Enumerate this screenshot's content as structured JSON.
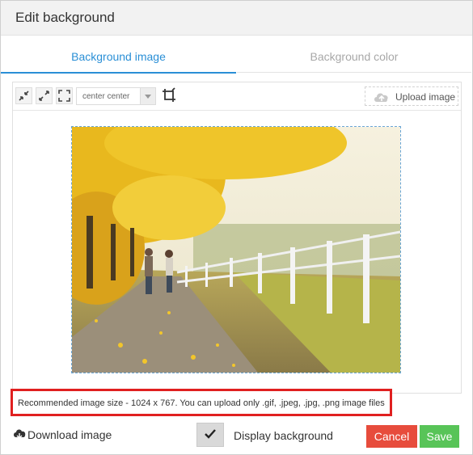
{
  "dialog": {
    "title": "Edit background"
  },
  "tabs": [
    {
      "label": "Background image",
      "active": true
    },
    {
      "label": "Background color",
      "active": false
    }
  ],
  "toolbar": {
    "icons": [
      "shrink-icon",
      "expand-icon",
      "fit-icon",
      "crop-icon"
    ],
    "position_select": {
      "value": "center center"
    },
    "upload_label": "Upload image"
  },
  "preview": {
    "alt": "autumn path with couple walking beside fence"
  },
  "note": {
    "text": "Recommended image size - 1024 x 767. You can upload only .gif, .jpeg, .jpg, .png image files"
  },
  "footer": {
    "download_label": "Download image",
    "display_label": "Display background",
    "display_checked": true,
    "cancel_label": "Cancel",
    "save_label": "Save"
  },
  "colors": {
    "accent": "#2a8fd6",
    "cancel": "#e74c3c",
    "save": "#58c458",
    "highlight": "#e02020"
  }
}
